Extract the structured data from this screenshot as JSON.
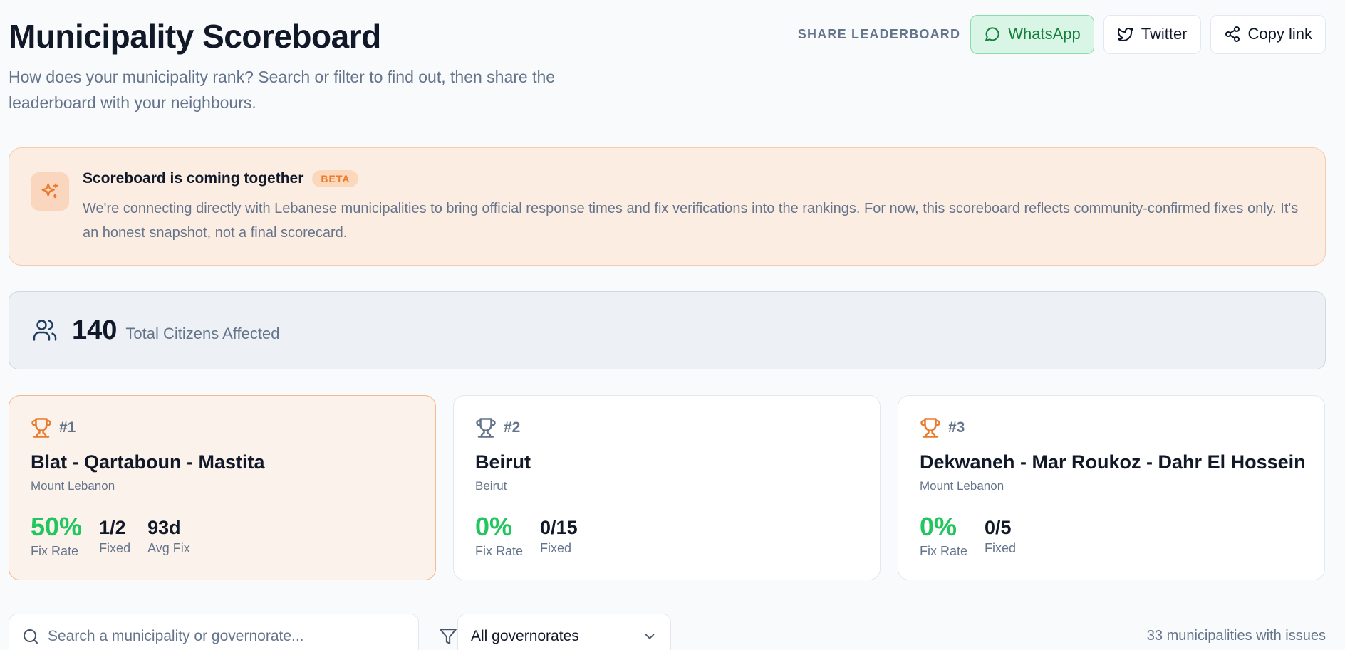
{
  "header": {
    "title": "Municipality Scoreboard",
    "subtitle": "How does your municipality rank? Search or filter to find out, then share the leaderboard with your neighbours.",
    "share_label": "SHARE LEADERBOARD",
    "share_buttons": [
      {
        "label": "WhatsApp",
        "icon": "whatsapp-icon"
      },
      {
        "label": "Twitter",
        "icon": "twitter-icon"
      },
      {
        "label": "Copy link",
        "icon": "share-icon"
      }
    ]
  },
  "banner": {
    "title": "Scoreboard is coming together",
    "badge": "BETA",
    "body": "We're connecting directly with Lebanese municipalities to bring official response times and fix verifications into the rankings. For now, this scoreboard reflects community-confirmed fixes only. It's an honest snapshot, not a final scorecard.",
    "icon": "sparkles-icon"
  },
  "stats": {
    "value": "140",
    "label": "Total Citizens Affected",
    "icon": "users-icon"
  },
  "podium": [
    {
      "rank": "#1",
      "name": "Blat - Qartaboun - Mastita",
      "region": "Mount Lebanon",
      "fix_rate": "50%",
      "fix_rate_label": "Fix Rate",
      "fixed": "1/2",
      "fixed_label": "Fixed",
      "avg_fix": "93d",
      "avg_fix_label": "Avg Fix",
      "trophy_color": "#ea7a2e"
    },
    {
      "rank": "#2",
      "name": "Beirut",
      "region": "Beirut",
      "fix_rate": "0%",
      "fix_rate_label": "Fix Rate",
      "fixed": "0/15",
      "fixed_label": "Fixed",
      "trophy_color": "#64748b"
    },
    {
      "rank": "#3",
      "name": "Dekwaneh - Mar Roukoz - Dahr El Hossein",
      "region": "Mount Lebanon",
      "fix_rate": "0%",
      "fix_rate_label": "Fix Rate",
      "fixed": "0/5",
      "fixed_label": "Fixed",
      "trophy_color": "#ea7a2e"
    }
  ],
  "filters": {
    "search_placeholder": "Search a municipality or governorate...",
    "search_value": "",
    "governorate_selected": "All governorates",
    "count_text": "33 municipalities with issues"
  },
  "colors": {
    "accent": "#ea7a2e",
    "success": "#22c55e",
    "whatsapp": "#15803d"
  }
}
